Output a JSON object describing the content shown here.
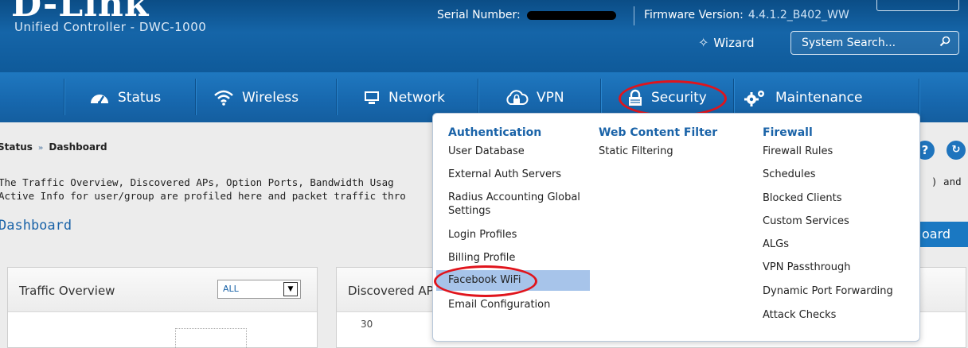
{
  "header": {
    "logo": "D-Link",
    "subtitle": "Unified Controller - DWC-1000",
    "serial_label": "Serial Number:",
    "firmware_label": "Firmware Version:",
    "firmware_value": "4.4.1.2_B402_WW",
    "wizard_label": "Wizard",
    "search_placeholder": "System Search..."
  },
  "nav": {
    "items": [
      {
        "label": "Status",
        "icon": "speedometer-icon"
      },
      {
        "label": "Wireless",
        "icon": "wifi-icon"
      },
      {
        "label": "Network",
        "icon": "monitor-icon"
      },
      {
        "label": "VPN",
        "icon": "cloud-lock-icon"
      },
      {
        "label": "Security",
        "icon": "padlock-icon"
      },
      {
        "label": "Maintenance",
        "icon": "gears-icon"
      }
    ]
  },
  "breadcrumb": {
    "root": "Status",
    "separator": "»",
    "current": "Dashboard"
  },
  "description": {
    "line1": "The Traffic Overview, Discovered APs, Option Ports, Bandwidth Usag",
    "line2": "Active Info for user/group are profiled here and packet traffic thro",
    "line1_tail": ") and"
  },
  "page_title": "Dashboard",
  "dashboard_button": "oard",
  "help_button": "?",
  "panels": {
    "traffic": {
      "title": "Traffic Overview",
      "select_value": "ALL"
    },
    "discovered": {
      "title": "Discovered AP",
      "y_tick": "30"
    }
  },
  "dropdown": {
    "authentication": {
      "heading": "Authentication",
      "items": [
        "User Database",
        "External Auth Servers",
        "Radius Accounting Global Settings",
        "Login Profiles",
        "Billing Profile",
        "Facebook WiFi",
        "Email Configuration"
      ]
    },
    "web_content_filter": {
      "heading": "Web Content Filter",
      "items": [
        "Static Filtering"
      ]
    },
    "firewall": {
      "heading": "Firewall",
      "items": [
        "Firewall Rules",
        "Schedules",
        "Blocked Clients",
        "Custom Services",
        "ALGs",
        "VPN Passthrough",
        "Dynamic Port Forwarding",
        "Attack Checks"
      ]
    },
    "highlighted_item": "Facebook WiFi"
  },
  "colors": {
    "header": "#0f5a9a",
    "nav": "#1767ad",
    "accent": "#1a63a8",
    "annotation": "#e0141c",
    "highlight": "#a7c4ea"
  }
}
